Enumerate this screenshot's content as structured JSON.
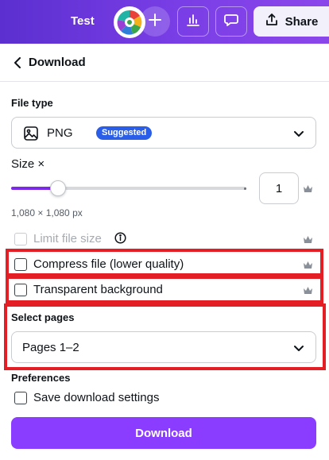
{
  "topbar": {
    "doc_title": "Test",
    "share_label": "Share",
    "icons": [
      "plus-icon",
      "stats-icon",
      "comment-icon",
      "share-icon"
    ]
  },
  "panel": {
    "title": "Download"
  },
  "file_type": {
    "label": "File type",
    "value": "PNG",
    "badge": "Suggested",
    "icon": "image-icon"
  },
  "size": {
    "label": "Size ×",
    "multiplier": "1",
    "dimensions": "1,080 × 1,080 px",
    "slider_fraction": 0.2
  },
  "options": {
    "limit_file_size": "Limit file size",
    "compress_file": "Compress file (lower quality)",
    "transparent_background": "Transparent background"
  },
  "select_pages": {
    "label": "Select pages",
    "value": "Pages 1–2"
  },
  "preferences": {
    "label": "Preferences",
    "save_settings": "Save download settings"
  },
  "download_button": "Download",
  "colors": {
    "accent": "#8b3dff",
    "highlight": "#e31e24",
    "badge": "#2a5ee8"
  }
}
